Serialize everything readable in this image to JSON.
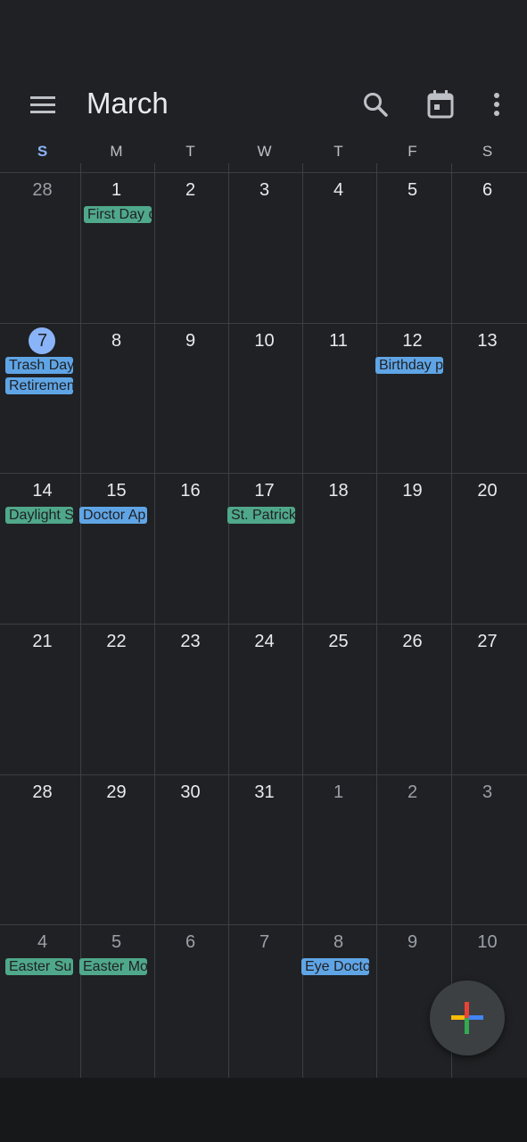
{
  "header": {
    "month_title": "March",
    "menu_icon": "menu-icon",
    "search_icon": "search-icon",
    "today_icon": "calendar-today-icon",
    "more_icon": "more-vert-icon"
  },
  "weekdays": [
    "S",
    "M",
    "T",
    "W",
    "T",
    "F",
    "S"
  ],
  "weeks": [
    [
      "28",
      "1",
      "2",
      "3",
      "4",
      "5",
      "6"
    ],
    [
      "7",
      "8",
      "9",
      "10",
      "11",
      "12",
      "13"
    ],
    [
      "14",
      "15",
      "16",
      "17",
      "18",
      "19",
      "20"
    ],
    [
      "21",
      "22",
      "23",
      "24",
      "25",
      "26",
      "27"
    ],
    [
      "28",
      "29",
      "30",
      "31",
      "1",
      "2",
      "3"
    ],
    [
      "4",
      "5",
      "6",
      "7",
      "8",
      "9",
      "10"
    ]
  ],
  "events": {
    "mar1": "First Day o",
    "mar7_a": "Trash Day",
    "mar7_b": "Retiremen",
    "mar12": "Birthday p",
    "mar14": "Daylight S",
    "mar15": "Doctor Ap",
    "mar17": "St. Patrick",
    "apr4": "Easter Su",
    "apr5": "Easter Mo",
    "apr8": "Eye Docto"
  },
  "fab": {
    "icon": "plus-icon"
  },
  "colors": {
    "background": "#202124",
    "today_circle": "#8ab4f8",
    "event_green": "#4fa88a",
    "event_blue": "#5fa5e6"
  }
}
